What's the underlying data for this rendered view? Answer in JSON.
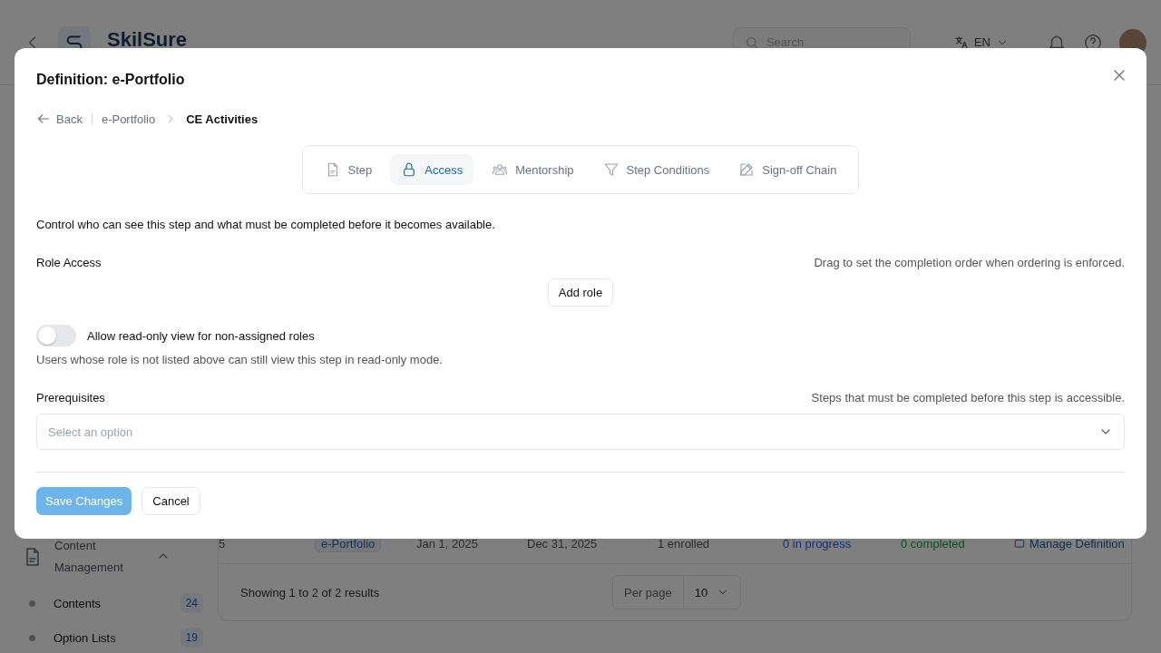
{
  "header": {
    "brand": "SkilSure",
    "search_placeholder": "Search",
    "language": "EN"
  },
  "sidebar": {
    "group": {
      "label": "Content Management",
      "expanded": true
    },
    "items": [
      {
        "label": "Contents",
        "count": "24"
      },
      {
        "label": "Option Lists",
        "count": "19"
      }
    ]
  },
  "table": {
    "row": {
      "column_1": "5",
      "tag": "e-Portfolio",
      "start": "Jan 1, 2025",
      "end": "Dec 31, 2025",
      "enrolled": "1 enrolled",
      "in_progress": "0 in progress",
      "completed": "0 completed",
      "action": "Manage Definition"
    },
    "summary": "Showing 1 to 2 of 2 results",
    "per_page_label": "Per page",
    "per_page": "10"
  },
  "dialog": {
    "title": "Definition: e-Portfolio",
    "breadcrumb": {
      "back": "Back",
      "parent": "e-Portfolio",
      "current": "CE Activities"
    },
    "tabs": [
      {
        "label": "Step",
        "selected": false
      },
      {
        "label": "Access",
        "selected": true
      },
      {
        "label": "Mentorship",
        "selected": false
      },
      {
        "label": "Step Conditions",
        "selected": false
      },
      {
        "label": "Sign-off Chain",
        "selected": false
      }
    ],
    "description": "Control who can see this step and what must be completed before it becomes available.",
    "role_access": {
      "label": "Role Access",
      "hint": "Drag to set the completion order when ordering is enforced.",
      "button": "Add role"
    },
    "read_only": {
      "label": "Allow read-only view for non-assigned roles",
      "on": false,
      "help": "Users whose role is not listed above can still view this step in read-only mode."
    },
    "prerequisites": {
      "label": "Prerequisites",
      "hint": "Steps that must be completed before this step is accessible.",
      "placeholder": "Select an option"
    },
    "save": {
      "label": "Save Changes",
      "disabled": true
    },
    "cancel": "Cancel"
  }
}
